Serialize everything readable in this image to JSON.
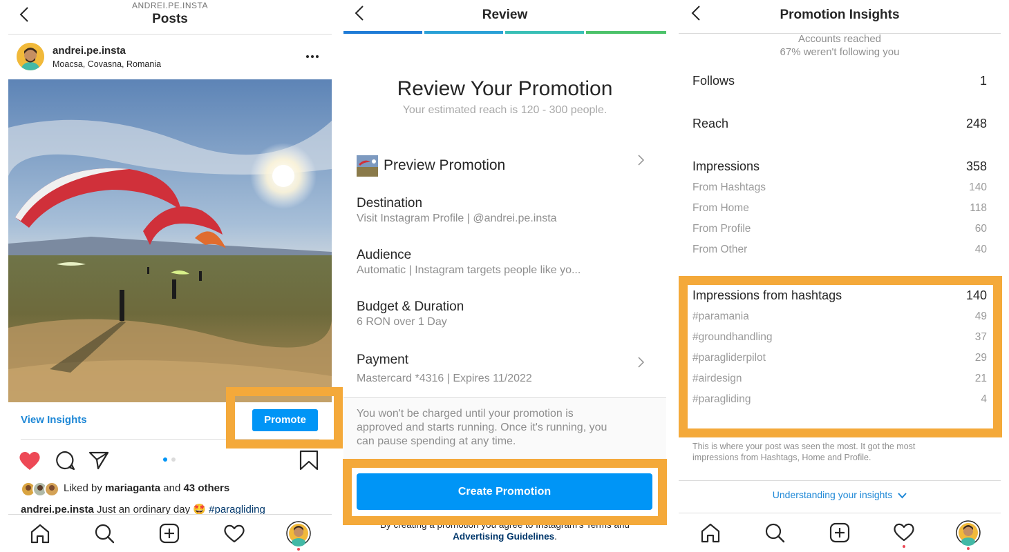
{
  "posts": {
    "header_username": "ANDREI.PE.INSTA",
    "header_title": "Posts",
    "username": "andrei.pe.insta",
    "location": "Moacsa, Covasna, Romania",
    "view_insights": "View Insights",
    "promote": "Promote",
    "liked_prefix": "Liked by ",
    "liked_user": "mariaganta",
    "liked_and": " and ",
    "liked_others": "43 others",
    "caption_user": "andrei.pe.insta",
    "caption_text": " Just an ordinary day 🤩 ",
    "caption_tag": "#paragliding"
  },
  "review": {
    "header_title": "Review",
    "heading": "Review Your Promotion",
    "subheading": "Your estimated reach is 120 - 300 people.",
    "preview_label": "Preview Promotion",
    "destination_label": "Destination",
    "destination_value": "Visit Instagram Profile | @andrei.pe.insta",
    "audience_label": "Audience",
    "audience_value": "Automatic | Instagram targets people like yo...",
    "budget_label": "Budget & Duration",
    "budget_value": "6 RON over 1 Day",
    "payment_label": "Payment",
    "payment_value": "Mastercard *4316 | Expires 11/2022",
    "notice_line1": "You won't be charged until your promotion is",
    "notice_line2": "approved and starts running. Once it's running, you",
    "notice_line3": "can pause spending at any time.",
    "create_button": "Create Promotion",
    "terms_text": "By creating a promotion you agree to Instagram's Terms and",
    "terms_link": "Advertising Guidelines",
    "terms_end": "."
  },
  "insights": {
    "header_title": "Promotion Insights",
    "accounts_reached": "Accounts reached",
    "not_following": "67% weren't following you",
    "follows_label": "Follows",
    "follows_value": "1",
    "reach_label": "Reach",
    "reach_value": "248",
    "impressions_label": "Impressions",
    "impressions_value": "358",
    "sources": [
      {
        "label": "From Hashtags",
        "value": "140"
      },
      {
        "label": "From Home",
        "value": "118"
      },
      {
        "label": "From Profile",
        "value": "60"
      },
      {
        "label": "From Other",
        "value": "40"
      }
    ],
    "hashtags_label": "Impressions from hashtags",
    "hashtags_value": "140",
    "hashtags": [
      {
        "label": "#paramania",
        "value": "49"
      },
      {
        "label": "#groundhandling",
        "value": "37"
      },
      {
        "label": "#paragliderpilot",
        "value": "29"
      },
      {
        "label": "#airdesign",
        "value": "21"
      },
      {
        "label": "#paragliding",
        "value": "4"
      }
    ],
    "summary_line1": "This is where your post was seen the most. It got the most",
    "summary_line2": "impressions from Hashtags, Home and Profile.",
    "understanding_link": "Understanding your insights"
  },
  "colors": {
    "accent": "#0095f6",
    "highlight": "#f4a93a",
    "like_red": "#ed4956",
    "link_dark": "#00376b"
  },
  "icons": [
    "back-icon",
    "more-icon",
    "heart-filled-icon",
    "comment-icon",
    "share-icon",
    "bookmark-icon",
    "home-icon",
    "search-icon",
    "add-icon",
    "heart-icon",
    "chevron-right-icon",
    "chevron-down-icon"
  ]
}
